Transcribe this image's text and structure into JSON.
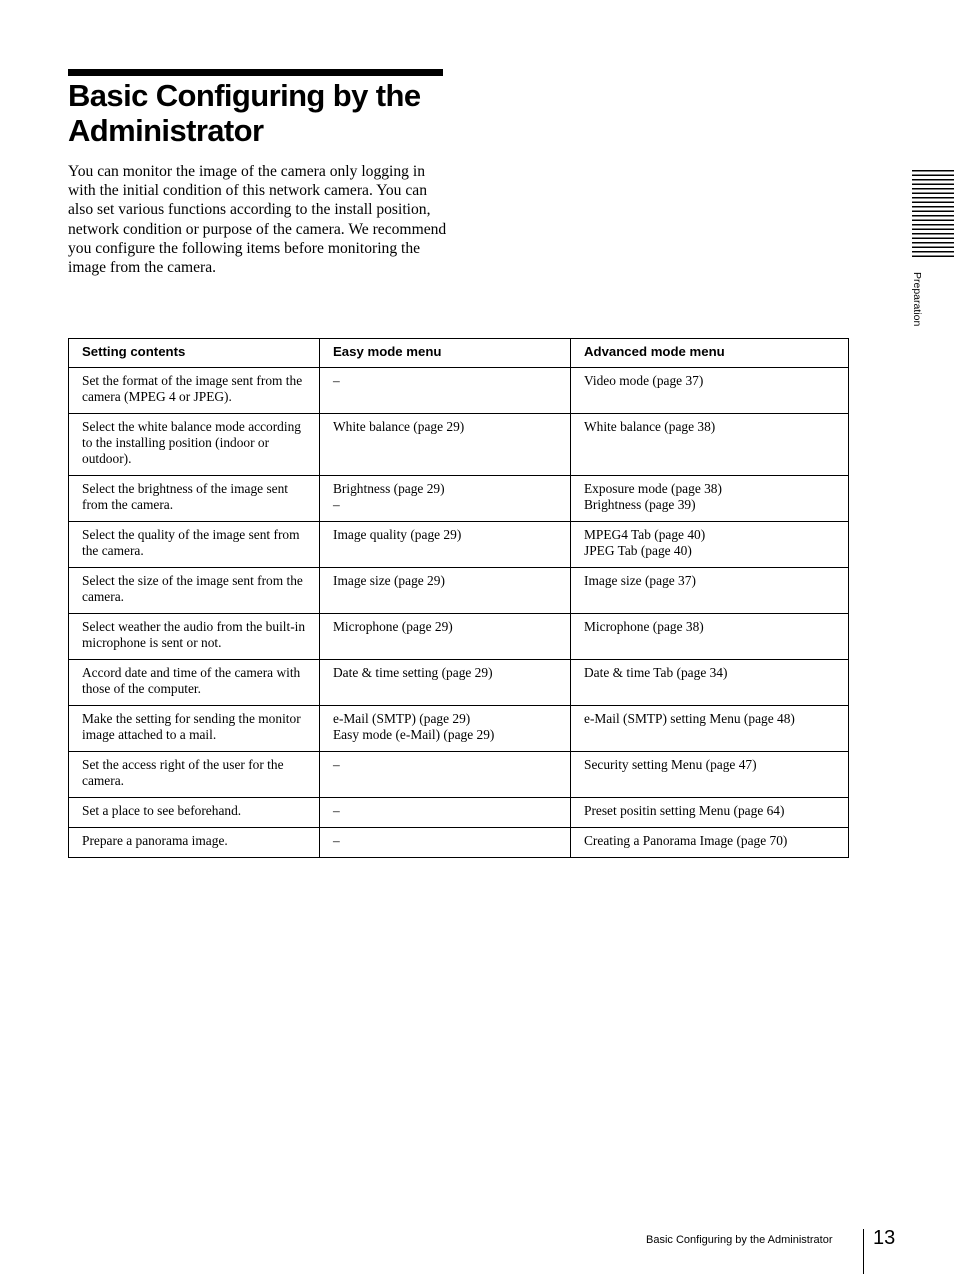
{
  "page": {
    "title": "Basic Configuring by the Administrator",
    "intro": "You can monitor the image of the camera only logging in with the initial condition of this network camera. You can also set various functions according to the install position, network condition or purpose of the camera. We recommend you configure the following items before monitoring the image from the camera."
  },
  "side_tab": {
    "label": "Preparation"
  },
  "table": {
    "headers": [
      "Setting contents",
      "Easy mode menu",
      "Advanced mode menu"
    ],
    "rows": [
      {
        "setting": "Set the format of the image sent from the camera (MPEG 4 or JPEG).",
        "easy": [
          "–"
        ],
        "advanced": [
          "Video mode (page 37)"
        ]
      },
      {
        "setting": "Select the white balance mode according to the installing position (indoor or outdoor).",
        "easy": [
          "White balance (page 29)"
        ],
        "advanced": [
          "White balance (page 38)"
        ]
      },
      {
        "setting": "Select the brightness of the image sent from the camera.",
        "easy": [
          "Brightness (page 29)",
          "–"
        ],
        "advanced": [
          "Exposure mode (page 38)",
          "Brightness (page 39)"
        ]
      },
      {
        "setting": "Select the quality of the image sent from the camera.",
        "easy": [
          "Image quality (page 29)"
        ],
        "advanced": [
          "MPEG4 Tab (page 40)",
          "JPEG Tab (page 40)"
        ]
      },
      {
        "setting": "Select the size of the image sent from the camera.",
        "easy": [
          "Image size (page 29)"
        ],
        "advanced": [
          "Image size (page 37)"
        ]
      },
      {
        "setting": "Select weather the audio from the built-in microphone is sent or not.",
        "easy": [
          "Microphone (page 29)"
        ],
        "advanced": [
          "Microphone (page 38)"
        ]
      },
      {
        "setting": "Accord date and time of the camera with those of the computer.",
        "easy": [
          "Date & time setting (page 29)"
        ],
        "advanced": [
          "Date & time Tab (page 34)"
        ]
      },
      {
        "setting": "Make the setting for sending the monitor image attached to a mail.",
        "easy": [
          "e-Mail (SMTP) (page 29)",
          "Easy mode (e-Mail) (page 29)"
        ],
        "advanced": [
          "e-Mail (SMTP) setting Menu (page 48)"
        ]
      },
      {
        "setting": "Set the access right of the user for the camera.",
        "easy": [
          "–"
        ],
        "advanced": [
          "Security setting Menu (page 47)"
        ]
      },
      {
        "setting": "Set a place to see beforehand.",
        "easy": [
          "–"
        ],
        "advanced": [
          "Preset positin setting Menu (page 64)"
        ]
      },
      {
        "setting": "Prepare a panorama image.",
        "easy": [
          "–"
        ],
        "advanced": [
          "Creating a Panorama Image (page 70)"
        ]
      }
    ]
  },
  "footer": {
    "section_title": "Basic Configuring by the Administrator",
    "page_number": "13"
  }
}
